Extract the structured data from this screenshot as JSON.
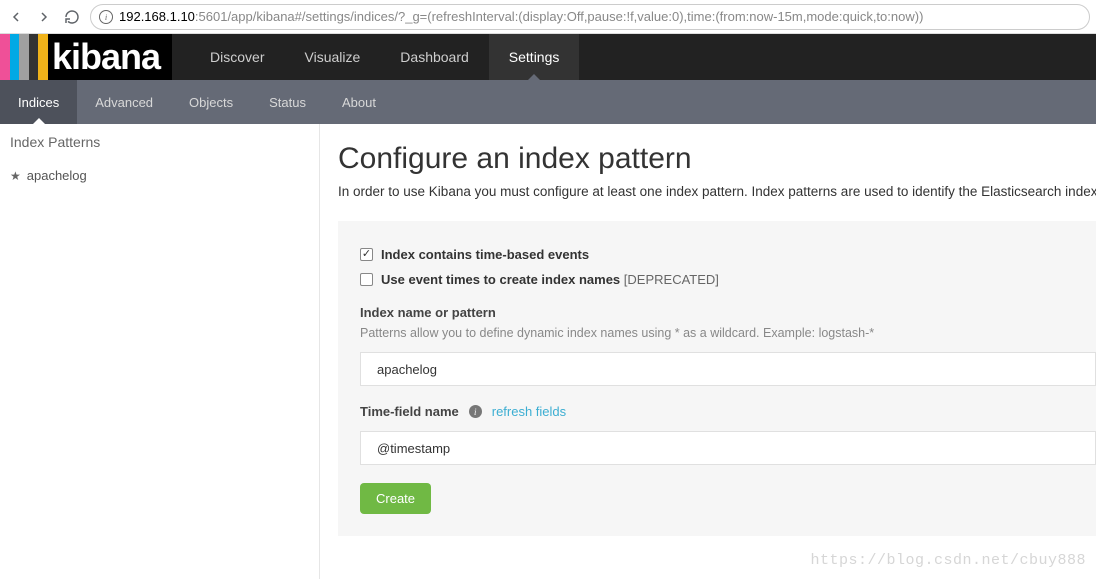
{
  "browser": {
    "url_host": "192.168.1.10",
    "url_path": ":5601/app/kibana#/settings/indices/?_g=(refreshInterval:(display:Off,pause:!f,value:0),time:(from:now-15m,mode:quick,to:now))"
  },
  "logo": {
    "text": "kibana",
    "stripes": [
      "#ef5098",
      "#00a9e5",
      "#a0a0a0",
      "#333333",
      "#f0b31a"
    ]
  },
  "topnav": {
    "items": [
      {
        "label": "Discover"
      },
      {
        "label": "Visualize"
      },
      {
        "label": "Dashboard"
      },
      {
        "label": "Settings"
      }
    ],
    "active": 3
  },
  "subnav": {
    "items": [
      {
        "label": "Indices"
      },
      {
        "label": "Advanced"
      },
      {
        "label": "Objects"
      },
      {
        "label": "Status"
      },
      {
        "label": "About"
      }
    ],
    "active": 0
  },
  "sidebar": {
    "header": "Index Patterns",
    "items": [
      {
        "label": "apachelog",
        "default": true
      }
    ]
  },
  "main": {
    "title": "Configure an index pattern",
    "description": "In order to use Kibana you must configure at least one index pattern. Index patterns are used to identify the Elasticsearch index to r",
    "check1_label": "Index contains time-based events",
    "check1_checked": true,
    "check2_label": "Use event times to create index names",
    "check2_deprecated": "[DEPRECATED]",
    "check2_checked": false,
    "index_label": "Index name or pattern",
    "index_hint": "Patterns allow you to define dynamic index names using * as a wildcard. Example: logstash-*",
    "index_value": "apachelog",
    "time_label": "Time-field name",
    "refresh_link": "refresh fields",
    "time_value": "@timestamp",
    "create_label": "Create"
  },
  "watermark": "https://blog.csdn.net/cbuy888"
}
